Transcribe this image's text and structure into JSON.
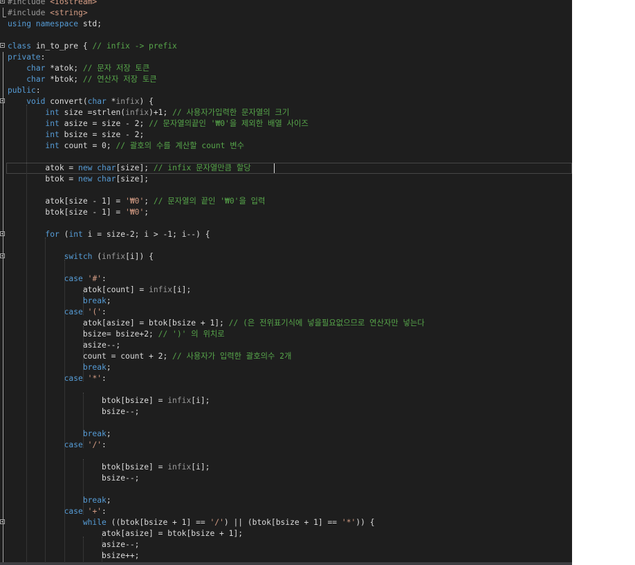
{
  "editor": {
    "lines": [
      {
        "fold": "minus",
        "tokens": [
          [
            "pp",
            "#include "
          ],
          [
            "str",
            "<iostream>"
          ]
        ]
      },
      {
        "fold": "end",
        "tokens": [
          [
            "pp",
            "#include "
          ],
          [
            "str",
            "<string>"
          ]
        ]
      },
      {
        "fold": "",
        "tokens": [
          [
            "kw",
            "using namespace "
          ],
          [
            "plain",
            "std;"
          ]
        ]
      },
      {
        "fold": "",
        "tokens": []
      },
      {
        "fold": "minus",
        "tokens": [
          [
            "kw",
            "class "
          ],
          [
            "plain",
            "in_to_pre { "
          ],
          [
            "cm",
            "// infix -> prefix"
          ]
        ]
      },
      {
        "fold": "",
        "tokens": [
          [
            "kw",
            "private"
          ],
          [
            "plain",
            ":"
          ]
        ]
      },
      {
        "fold": "",
        "tokens": [
          [
            "plain",
            "    "
          ],
          [
            "kw",
            "char "
          ],
          [
            "plain",
            "*atok; "
          ],
          [
            "cm",
            "// 문자 저장 토큰"
          ]
        ]
      },
      {
        "fold": "",
        "tokens": [
          [
            "plain",
            "    "
          ],
          [
            "kw",
            "char "
          ],
          [
            "plain",
            "*btok; "
          ],
          [
            "cm",
            "// 연산자 저장 토큰"
          ]
        ]
      },
      {
        "fold": "",
        "tokens": [
          [
            "kw",
            "public"
          ],
          [
            "plain",
            ":"
          ]
        ]
      },
      {
        "fold": "minus",
        "tokens": [
          [
            "plain",
            "    "
          ],
          [
            "kw",
            "void "
          ],
          [
            "plain",
            "convert("
          ],
          [
            "kw",
            "char "
          ],
          [
            "plain",
            "*"
          ],
          [
            "param",
            "infix"
          ],
          [
            "plain",
            ") {"
          ]
        ]
      },
      {
        "fold": "",
        "tokens": [
          [
            "plain",
            "        "
          ],
          [
            "kw",
            "int "
          ],
          [
            "plain",
            "size =strlen("
          ],
          [
            "param",
            "infix"
          ],
          [
            "plain",
            ")+1; "
          ],
          [
            "cm",
            "// 사용자가입력한 문자열의 크기"
          ]
        ]
      },
      {
        "fold": "",
        "tokens": [
          [
            "plain",
            "        "
          ],
          [
            "kw",
            "int "
          ],
          [
            "plain",
            "asize = size - 2; "
          ],
          [
            "cm",
            "// 문자열의끝인 '₩0'을 제외한 배열 사이즈"
          ]
        ]
      },
      {
        "fold": "",
        "tokens": [
          [
            "plain",
            "        "
          ],
          [
            "kw",
            "int "
          ],
          [
            "plain",
            "bsize = size - 2;"
          ]
        ]
      },
      {
        "fold": "",
        "tokens": [
          [
            "plain",
            "        "
          ],
          [
            "kw",
            "int "
          ],
          [
            "plain",
            "count = 0; "
          ],
          [
            "cm",
            "// 괄호의 수를 계산할 count 변수"
          ]
        ]
      },
      {
        "fold": "",
        "tokens": []
      },
      {
        "fold": "",
        "tokens": [
          [
            "plain",
            "        atok = "
          ],
          [
            "kw",
            "new char"
          ],
          [
            "plain",
            "[size]; "
          ],
          [
            "cm",
            "// infix 문자열만큼 할당"
          ]
        ]
      },
      {
        "fold": "",
        "tokens": [
          [
            "plain",
            "        btok = "
          ],
          [
            "kw",
            "new char"
          ],
          [
            "plain",
            "[size];"
          ]
        ]
      },
      {
        "fold": "",
        "tokens": []
      },
      {
        "fold": "",
        "tokens": [
          [
            "plain",
            "        atok[size - 1] = "
          ],
          [
            "str",
            "'₩0'"
          ],
          [
            "plain",
            "; "
          ],
          [
            "cm",
            "// 문자열의 끝인 '₩0'을 입력"
          ]
        ]
      },
      {
        "fold": "",
        "tokens": [
          [
            "plain",
            "        btok[size - 1] = "
          ],
          [
            "str",
            "'₩0'"
          ],
          [
            "plain",
            ";"
          ]
        ]
      },
      {
        "fold": "",
        "tokens": []
      },
      {
        "fold": "minus",
        "tokens": [
          [
            "plain",
            "        "
          ],
          [
            "kw",
            "for "
          ],
          [
            "plain",
            "("
          ],
          [
            "kw",
            "int "
          ],
          [
            "plain",
            "i = size-2; i > -1; i--) {"
          ]
        ]
      },
      {
        "fold": "",
        "tokens": []
      },
      {
        "fold": "minus",
        "tokens": [
          [
            "plain",
            "            "
          ],
          [
            "kw",
            "switch "
          ],
          [
            "plain",
            "("
          ],
          [
            "param",
            "infix"
          ],
          [
            "plain",
            "[i]) {"
          ]
        ]
      },
      {
        "fold": "",
        "tokens": []
      },
      {
        "fold": "",
        "tokens": [
          [
            "plain",
            "            "
          ],
          [
            "kw",
            "case "
          ],
          [
            "str",
            "'#'"
          ],
          [
            "plain",
            ":"
          ]
        ]
      },
      {
        "fold": "",
        "tokens": [
          [
            "plain",
            "                atok[count] = "
          ],
          [
            "param",
            "infix"
          ],
          [
            "plain",
            "[i];"
          ]
        ]
      },
      {
        "fold": "",
        "tokens": [
          [
            "plain",
            "                "
          ],
          [
            "kw",
            "break"
          ],
          [
            "plain",
            ";"
          ]
        ]
      },
      {
        "fold": "",
        "tokens": [
          [
            "plain",
            "            "
          ],
          [
            "kw",
            "case "
          ],
          [
            "str",
            "'('"
          ],
          [
            "plain",
            ":"
          ]
        ]
      },
      {
        "fold": "",
        "tokens": [
          [
            "plain",
            "                atok[asize] = btok[bsize + 1]; "
          ],
          [
            "cm",
            "// (은 전위표기식에 넣을필요없으므로 연산자만 넣는다"
          ]
        ]
      },
      {
        "fold": "",
        "tokens": [
          [
            "plain",
            "                bsize= bsize+2; "
          ],
          [
            "cm",
            "// ')' 의 위치로"
          ]
        ]
      },
      {
        "fold": "",
        "tokens": [
          [
            "plain",
            "                asize--;"
          ]
        ]
      },
      {
        "fold": "",
        "tokens": [
          [
            "plain",
            "                count = count + 2; "
          ],
          [
            "cm",
            "// 사용자가 입력한 괄호의수 2개"
          ]
        ]
      },
      {
        "fold": "",
        "tokens": [
          [
            "plain",
            "                "
          ],
          [
            "kw",
            "break"
          ],
          [
            "plain",
            ";"
          ]
        ]
      },
      {
        "fold": "",
        "tokens": [
          [
            "plain",
            "            "
          ],
          [
            "kw",
            "case "
          ],
          [
            "str",
            "'*'"
          ],
          [
            "plain",
            ":"
          ]
        ]
      },
      {
        "fold": "",
        "tokens": []
      },
      {
        "fold": "",
        "tokens": [
          [
            "plain",
            "                    btok[bsize] = "
          ],
          [
            "param",
            "infix"
          ],
          [
            "plain",
            "[i];"
          ]
        ]
      },
      {
        "fold": "",
        "tokens": [
          [
            "plain",
            "                    bsize--;"
          ]
        ]
      },
      {
        "fold": "",
        "tokens": []
      },
      {
        "fold": "",
        "tokens": [
          [
            "plain",
            "                "
          ],
          [
            "kw",
            "break"
          ],
          [
            "plain",
            ";"
          ]
        ]
      },
      {
        "fold": "",
        "tokens": [
          [
            "plain",
            "            "
          ],
          [
            "kw",
            "case "
          ],
          [
            "str",
            "'/'"
          ],
          [
            "plain",
            ":"
          ]
        ]
      },
      {
        "fold": "",
        "tokens": []
      },
      {
        "fold": "",
        "tokens": [
          [
            "plain",
            "                    btok[bsize] = "
          ],
          [
            "param",
            "infix"
          ],
          [
            "plain",
            "[i];"
          ]
        ]
      },
      {
        "fold": "",
        "tokens": [
          [
            "plain",
            "                    bsize--;"
          ]
        ]
      },
      {
        "fold": "",
        "tokens": []
      },
      {
        "fold": "",
        "tokens": [
          [
            "plain",
            "                "
          ],
          [
            "kw",
            "break"
          ],
          [
            "plain",
            ";"
          ]
        ]
      },
      {
        "fold": "",
        "tokens": [
          [
            "plain",
            "            "
          ],
          [
            "kw",
            "case "
          ],
          [
            "str",
            "'+'"
          ],
          [
            "plain",
            ":"
          ]
        ]
      },
      {
        "fold": "minus",
        "tokens": [
          [
            "plain",
            "                "
          ],
          [
            "kw",
            "while "
          ],
          [
            "plain",
            "((btok[bsize + 1] == "
          ],
          [
            "str",
            "'/'"
          ],
          [
            "plain",
            ") || (btok[bsize + 1] == "
          ],
          [
            "str",
            "'*'"
          ],
          [
            "plain",
            ")) {"
          ]
        ]
      },
      {
        "fold": "",
        "tokens": [
          [
            "plain",
            "                    atok[asize] = btok[bsize + 1];"
          ]
        ]
      },
      {
        "fold": "",
        "tokens": [
          [
            "plain",
            "                    asize--;"
          ]
        ]
      },
      {
        "fold": "",
        "tokens": [
          [
            "plain",
            "                    bsize++;"
          ]
        ]
      }
    ],
    "colors": {
      "background": "#1e1e1e",
      "keyword": "#569cd6",
      "string": "#d69d85",
      "comment": "#57a64a",
      "preprocessor": "#9b9b9b",
      "text": "#dcdcdc"
    }
  }
}
